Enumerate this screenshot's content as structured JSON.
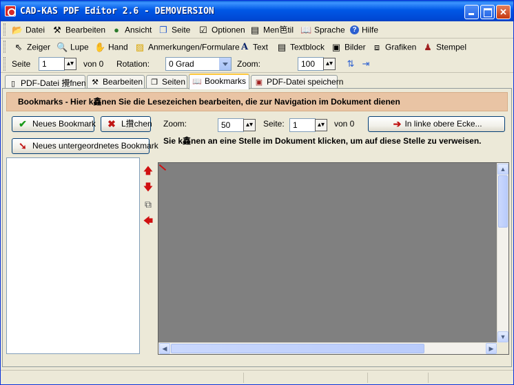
{
  "window": {
    "title": "CAD-KAS PDF Editor 2.6 - DEMOVERSION"
  },
  "menu": [
    {
      "label": "Datei",
      "icon": "folder-open-icon"
    },
    {
      "label": "Bearbeiten",
      "icon": "tools-icon"
    },
    {
      "label": "Ansicht",
      "icon": "globe-icon"
    },
    {
      "label": "Seite",
      "icon": "pages-icon"
    },
    {
      "label": "Optionen",
      "icon": "checklist-icon"
    },
    {
      "label": "Men笆til",
      "icon": "columns-icon"
    },
    {
      "label": "Sprache",
      "icon": "book-icon"
    },
    {
      "label": "Hilfe",
      "icon": "help-icon"
    }
  ],
  "toolbar": [
    {
      "label": "Zeiger",
      "icon": "pointer-icon"
    },
    {
      "label": "Lupe",
      "icon": "magnifier-icon"
    },
    {
      "label": "Hand",
      "icon": "hand-icon"
    },
    {
      "label": "Anmerkungen/Formulare",
      "icon": "annotation-icon"
    },
    {
      "label": "Text",
      "icon": "text-icon"
    },
    {
      "label": "Textblock",
      "icon": "textblock-icon"
    },
    {
      "label": "Bilder",
      "icon": "image-icon"
    },
    {
      "label": "Grafiken",
      "icon": "graphics-icon"
    },
    {
      "label": "Stempel",
      "icon": "stamp-icon"
    }
  ],
  "pagebar": {
    "seite_label": "Seite",
    "seite_value": "1",
    "von_label": "von 0",
    "rotation_label": "Rotation:",
    "rotation_value": "0 Grad",
    "zoom_label": "Zoom:",
    "zoom_value": "100"
  },
  "tabs": [
    {
      "label": "PDF-Datei 攪fnen",
      "icon": "file-icon"
    },
    {
      "label": "Bearbeiten",
      "icon": "tools-icon"
    },
    {
      "label": "Seiten",
      "icon": "pages-icon"
    },
    {
      "label": "Bookmarks",
      "icon": "book-icon",
      "active": true
    },
    {
      "label": "PDF-Datei speichern",
      "icon": "save-icon"
    }
  ],
  "bookmarks": {
    "banner": "Bookmarks - Hier k鑫nen Sie die Lesezeichen  bearbeiten, die zur Navigation im Dokument dienen",
    "new_bookmark": "Neues Bookmark",
    "delete": "L攢chen",
    "new_child_bookmark": "Neues untergeordnetes Bookmark",
    "zoom_label": "Zoom:",
    "zoom_value": "50",
    "seite_label": "Seite:",
    "seite_value": "1",
    "von_label": "von 0",
    "corner_button": "In linke obere Ecke...",
    "hint": "Sie k鑫nen an eine Stelle im Dokument klicken, um auf diese Stelle zu  verweisen."
  },
  "colors": {
    "banner_bg": "#e9c4a4",
    "title_bar": "#0058e6",
    "doc_bg": "#808080"
  }
}
